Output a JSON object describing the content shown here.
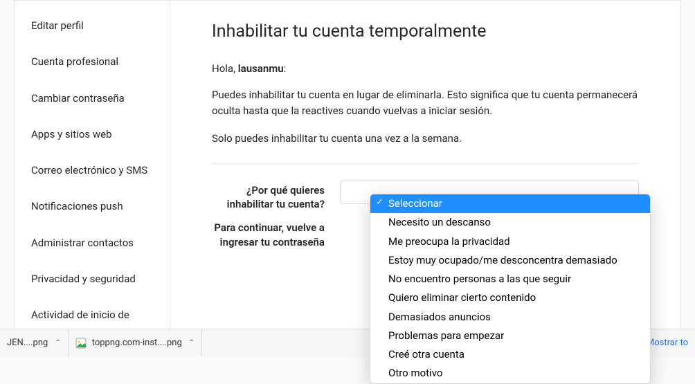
{
  "sidebar": {
    "items": [
      {
        "label": "Editar perfil"
      },
      {
        "label": "Cuenta profesional"
      },
      {
        "label": "Cambiar contraseña"
      },
      {
        "label": "Apps y sitios web"
      },
      {
        "label": "Correo electrónico y SMS"
      },
      {
        "label": "Notificaciones push"
      },
      {
        "label": "Administrar contactos"
      },
      {
        "label": "Privacidad y seguridad"
      },
      {
        "label": "Actividad de inicio de"
      }
    ]
  },
  "content": {
    "title": "Inhabilitar tu cuenta temporalmente",
    "greeting_prefix": "Hola, ",
    "username": "lausanmu",
    "greeting_suffix": ":",
    "para1": "Puedes inhabilitar tu cuenta en lugar de eliminarla. Esto significa que tu cuenta permanecerá oculta hasta que la reactives cuando vuelvas a iniciar sesión.",
    "para2": "Solo puedes inhabilitar tu cuenta una vez a la semana.",
    "reason_label": "¿Por qué quieres inhabilitar tu cuenta?",
    "password_label": "Para continuar, vuelve a ingresar tu contraseña"
  },
  "dropdown": {
    "options": [
      "Seleccionar",
      "Necesito un descanso",
      "Me preocupa la privacidad",
      "Estoy muy ocupado/me desconcentra demasiado",
      "No encuentro personas a las que seguir",
      "Quiero eliminar cierto contenido",
      "Demasiados anuncios",
      "Problemas para empezar",
      "Creé otra cuenta",
      "Otro motivo"
    ],
    "selected_index": 0
  },
  "downloads": {
    "items": [
      {
        "name": "JEN....png"
      },
      {
        "name": "toppng.com-inst....png"
      }
    ],
    "show_all": "Mostrar to"
  }
}
